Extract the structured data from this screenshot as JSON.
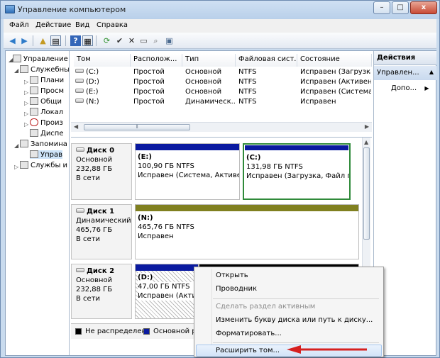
{
  "window": {
    "title": "Управление компьютером",
    "buttons": {
      "minimize": "–",
      "maximize": "□",
      "close": "x"
    }
  },
  "menu": [
    "Файл",
    "Действие",
    "Вид",
    "Справка"
  ],
  "tree": [
    {
      "label": "Управление к"
    },
    {
      "label": "Служебны"
    },
    {
      "label": "Плани"
    },
    {
      "label": "Просм"
    },
    {
      "label": "Общи"
    },
    {
      "label": "Локал"
    },
    {
      "label": "Произ"
    },
    {
      "label": "Диспе"
    },
    {
      "label": "Запомина"
    },
    {
      "label": "Управ"
    },
    {
      "label": "Службы и"
    }
  ],
  "volume_list": {
    "columns": [
      "Том",
      "Располож...",
      "Тип",
      "Файловая сист...",
      "Состояние"
    ],
    "rows": [
      [
        "(C:)",
        "Простой",
        "Основной",
        "NTFS",
        "Исправен (Загрузка,"
      ],
      [
        "(D:)",
        "Простой",
        "Основной",
        "NTFS",
        "Исправен (Активен, "
      ],
      [
        "(E:)",
        "Простой",
        "Основной",
        "NTFS",
        "Исправен (Система, "
      ],
      [
        "(N:)",
        "Простой",
        "Динамическ...",
        "NTFS",
        "Исправен"
      ]
    ]
  },
  "disks": [
    {
      "name": "Диск 0",
      "type": "Основной",
      "size": "232,88 ГБ",
      "status": "В сети",
      "partitions": [
        {
          "letter": "(E:)",
          "size": "100,90 ГБ NTFS",
          "status": "Исправен (Система, Активен"
        },
        {
          "letter": "(C:)",
          "size": "131,98 ГБ NTFS",
          "status": "Исправен (Загрузка, Файл п"
        }
      ]
    },
    {
      "name": "Диск 1",
      "type": "Динамический",
      "size": "465,76 ГБ",
      "status": "В сети",
      "partitions": [
        {
          "letter": "(N:)",
          "size": "465,76 ГБ NTFS",
          "status": "Исправен"
        }
      ]
    },
    {
      "name": "Диск 2",
      "type": "Основной",
      "size": "232,88 ГБ",
      "status": "В сети",
      "partitions": [
        {
          "letter": "(D:)",
          "size": "47,00 ГБ NTFS",
          "status": "Исправен (Актив"
        }
      ]
    }
  ],
  "legend": [
    "Не распределен",
    "Основной раз"
  ],
  "actions": {
    "header": "Действия",
    "sub": "Управлен...",
    "item": "Допо..."
  },
  "context_menu": [
    {
      "label": "Открыть",
      "disabled": false
    },
    {
      "label": "Проводник",
      "disabled": false
    },
    {
      "label": "Сделать раздел активным",
      "disabled": true
    },
    {
      "label": "Изменить букву диска или путь к диску...",
      "disabled": false
    },
    {
      "label": "Форматировать...",
      "disabled": false
    },
    {
      "label": "Расширить том...",
      "disabled": false,
      "highlighted": true
    }
  ],
  "colors": {
    "primary_partition": "#0a1aa0",
    "dynamic_volume": "#808020",
    "unallocated": "#000000",
    "arrow": "#d62020"
  }
}
